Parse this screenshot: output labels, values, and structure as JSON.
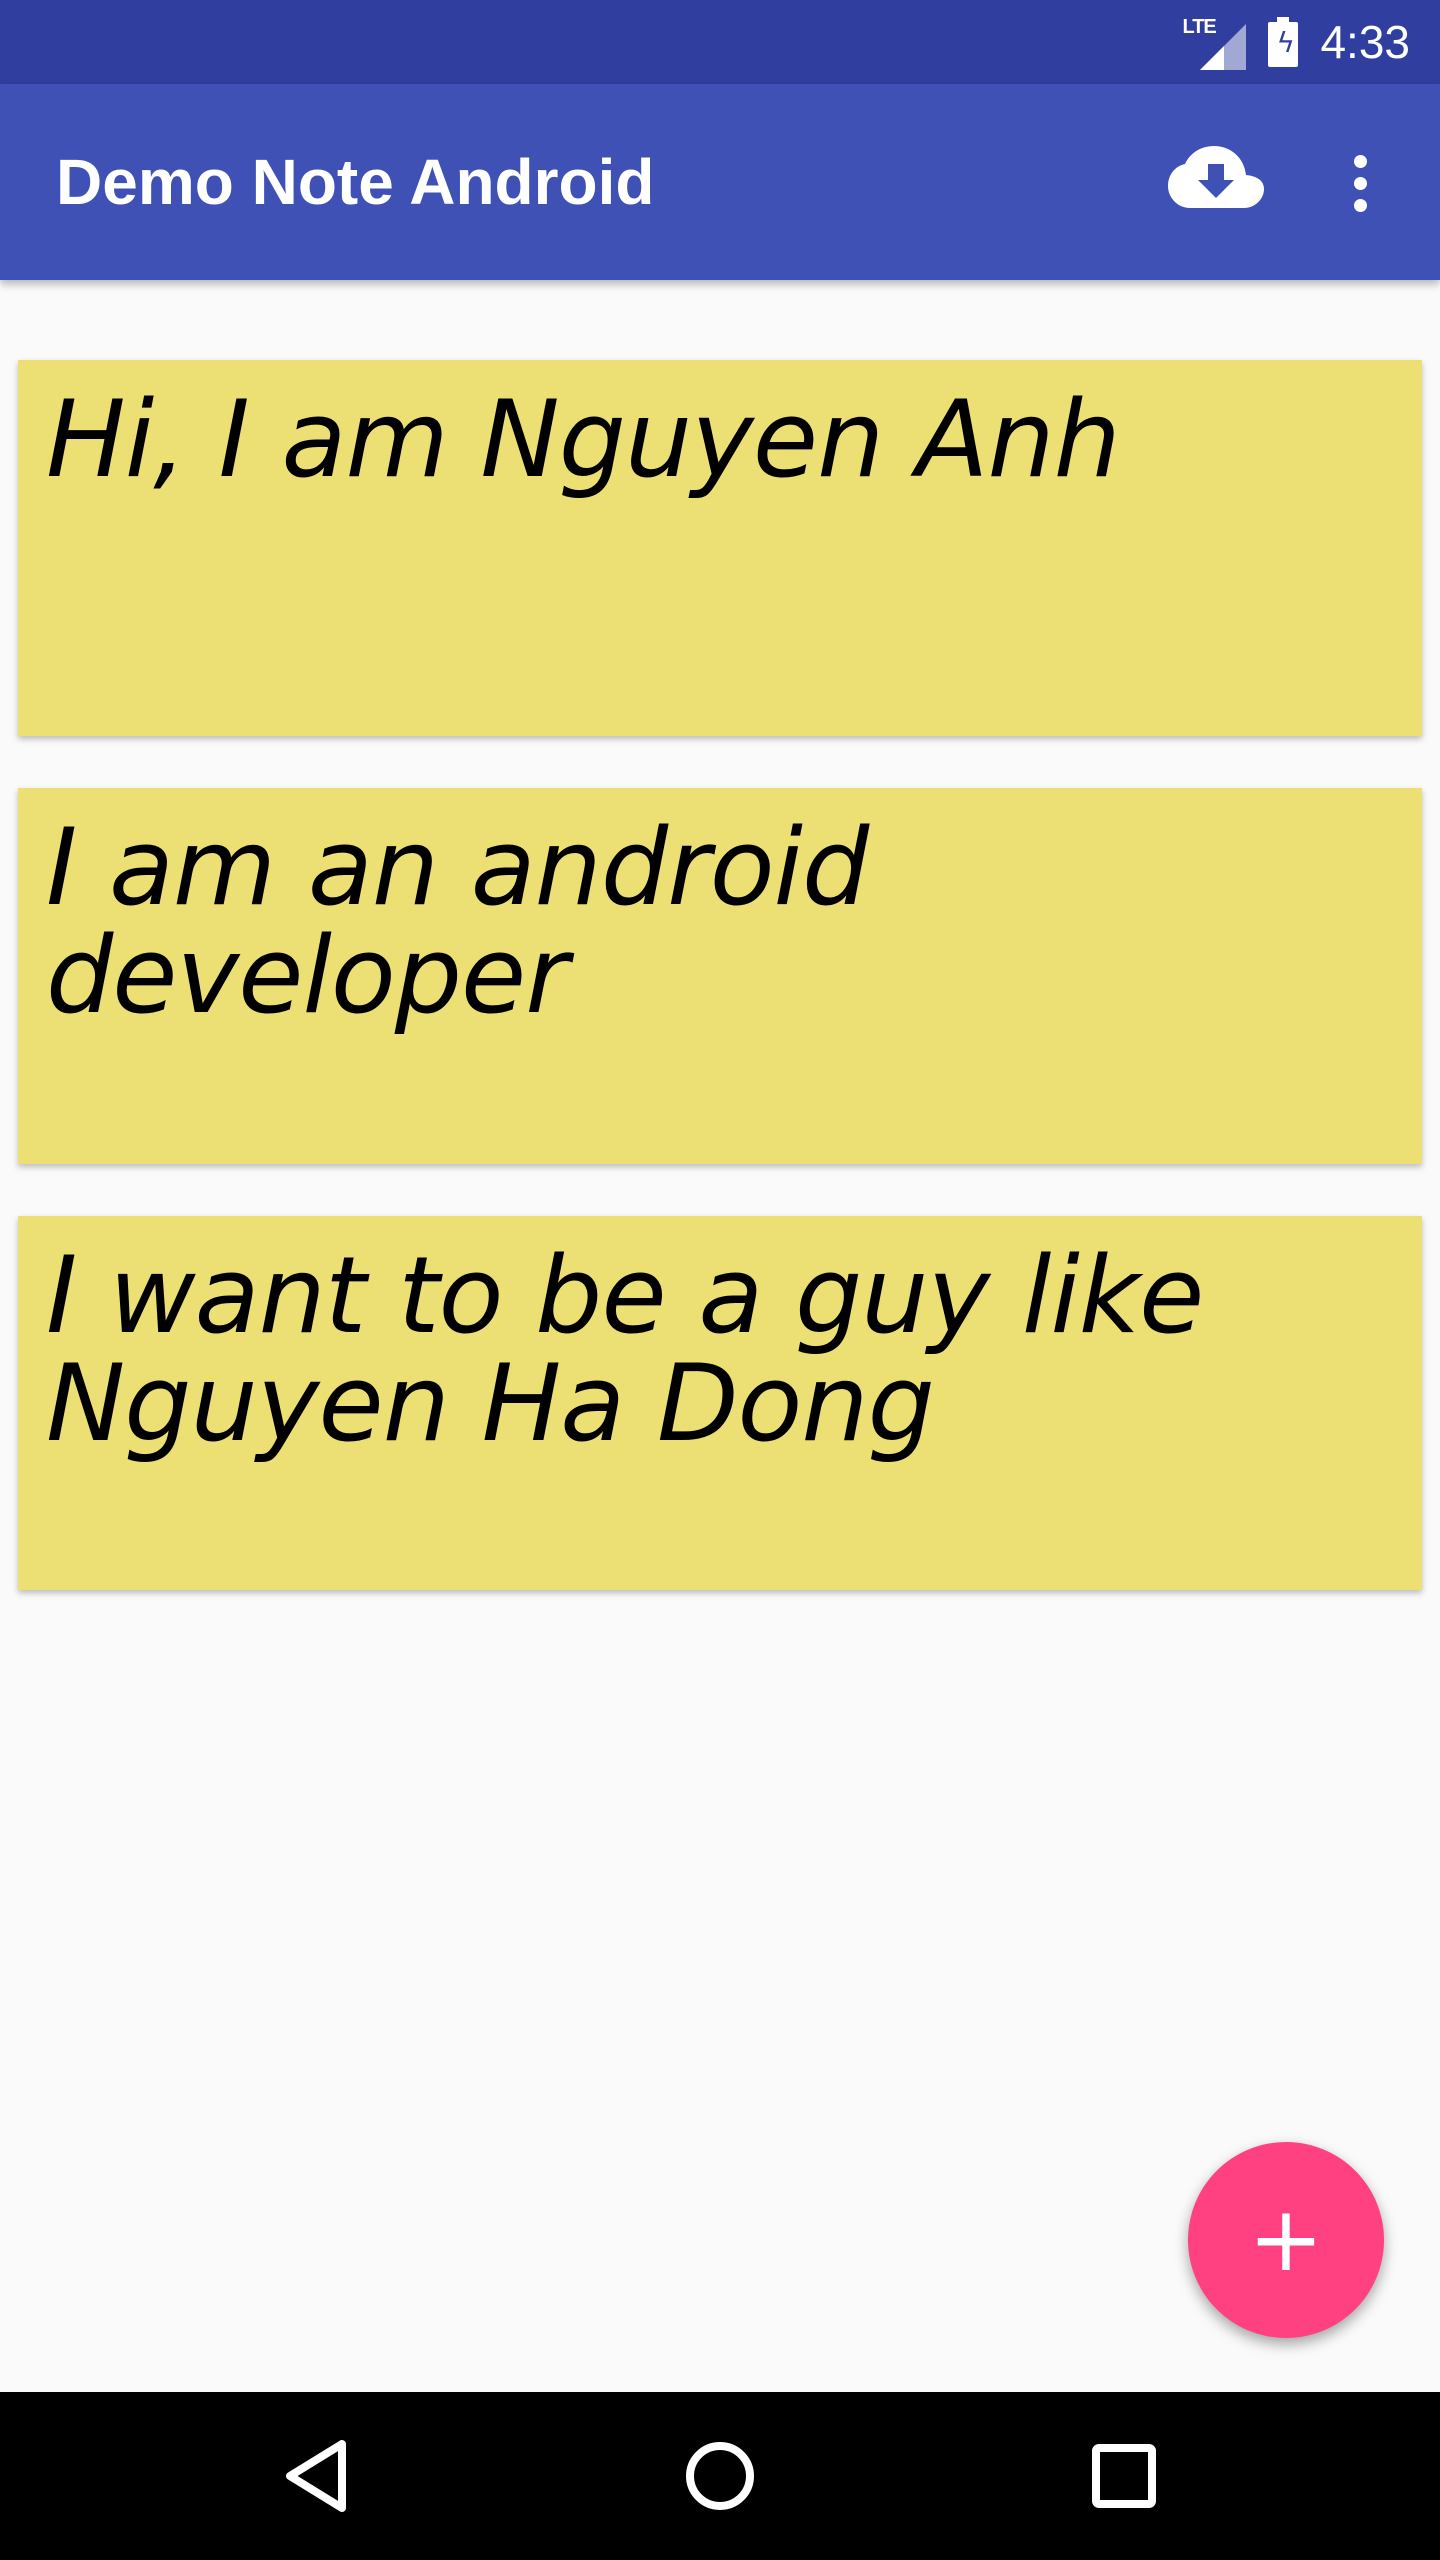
{
  "status_bar": {
    "network_label": "LTE",
    "time": "4:33",
    "icons": [
      "lte-signal-icon",
      "battery-charging-icon"
    ]
  },
  "app_bar": {
    "title": "Demo Note Android",
    "actions": [
      "cloud-download-icon",
      "more-vert-icon"
    ]
  },
  "notes": [
    {
      "text": "Hi, I am Nguyen Anh"
    },
    {
      "text": "I am an android developer"
    },
    {
      "text": "I want to be a guy like Nguyen Ha Dong"
    }
  ],
  "fab": {
    "label": "+",
    "icon": "add-icon",
    "color": "#ff4081"
  },
  "nav_bar": {
    "icons": [
      "back-icon",
      "home-icon",
      "recents-icon"
    ]
  },
  "colors": {
    "status_bar": "#303f9f",
    "primary": "#3f51b5",
    "note_background": "#ecdf73",
    "background": "#fafafa"
  }
}
